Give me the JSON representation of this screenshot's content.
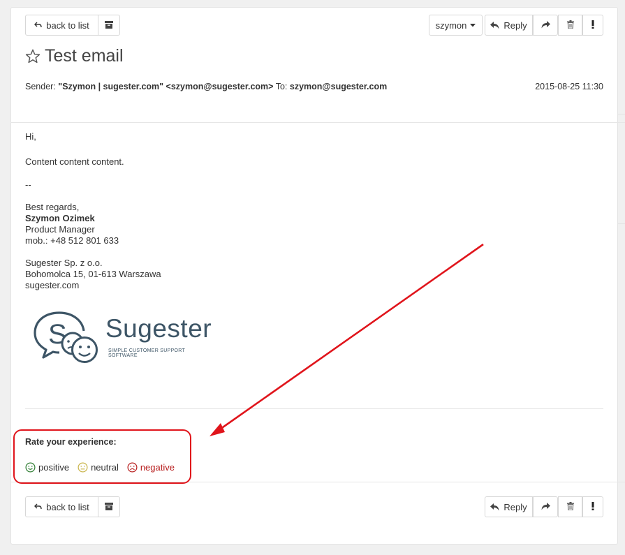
{
  "toolbar_top": {
    "back_label": "back to list",
    "user_label": "szymon",
    "reply_label": "Reply"
  },
  "email": {
    "subject": "Test email",
    "sender_prefix": "Sender:",
    "sender_value": "\"Szymon | sugester.com\" <szymon@sugester.com>",
    "to_prefix": "To:",
    "to_value": "szymon@sugester.com",
    "date": "2015-08-25 11:30",
    "greeting": "Hi,",
    "content": "Content content content.",
    "separator": "--",
    "regards": "Best regards,",
    "signer_name": "Szymon Ozimek",
    "signer_role": "Product Manager",
    "signer_phone": "mob.: +48 512 801 633",
    "company_name": "Sugester Sp. z o.o.",
    "company_address": "Bohomolca 15, 01-613 Warszawa",
    "company_site": "sugester.com"
  },
  "logo": {
    "brand": "Sugester",
    "tagline": "SIMPLE CUSTOMER SUPPORT SOFTWARE"
  },
  "rating": {
    "title": "Rate your experience:",
    "positive": "positive",
    "neutral": "neutral",
    "negative": "negative",
    "colors": {
      "positive": "#2e7d32",
      "neutral": "#c9b44a",
      "negative": "#b71c1c"
    }
  },
  "toolbar_bottom": {
    "back_label": "back to list",
    "reply_label": "Reply"
  },
  "annotation": {
    "color": "#e0141b"
  }
}
